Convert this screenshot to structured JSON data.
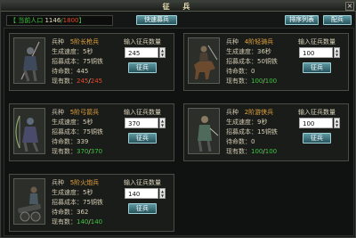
{
  "window": {
    "title": "征 兵",
    "close_glyph": "×"
  },
  "population": {
    "label": "【 当前人口",
    "current": "1146",
    "sep": "/",
    "max": "1800",
    "end": "】"
  },
  "toolbar": {
    "quick": "快速募兵",
    "sort": "排序列表",
    "equip": "配兵"
  },
  "labels": {
    "type": "兵种",
    "speed": "生成速度：",
    "cost": "招募成本",
    "pending": "待命数：",
    "owned": "现有数：",
    "input": "输入征兵数量",
    "go": "征兵"
  },
  "units": [
    {
      "name": "5阶长枪兵",
      "speed": "5秒",
      "cost": "75铜铁",
      "pending": "445",
      "owned_cur": "245",
      "owned_max": "245",
      "input": "245"
    },
    {
      "name": "4阶轻骑兵",
      "speed": "36秒",
      "cost": "50铜铁",
      "pending": "0",
      "owned_cur": "100",
      "owned_max": "100",
      "input": "100"
    },
    {
      "name": "5阶弓箭兵",
      "speed": "5秒",
      "cost": "75铜铁",
      "pending": "339",
      "owned_cur": "370",
      "owned_max": "370",
      "input": "370"
    },
    {
      "name": "2阶游侠兵",
      "speed": "9秒",
      "cost": "15铜铁",
      "pending": "0",
      "owned_cur": "100",
      "owned_max": "100",
      "input": "100"
    },
    {
      "name": "5阶火炮兵",
      "speed": "5秒",
      "cost": "75铜铁",
      "pending": "362",
      "owned_cur": "140",
      "owned_max": "140",
      "input": "140"
    }
  ]
}
